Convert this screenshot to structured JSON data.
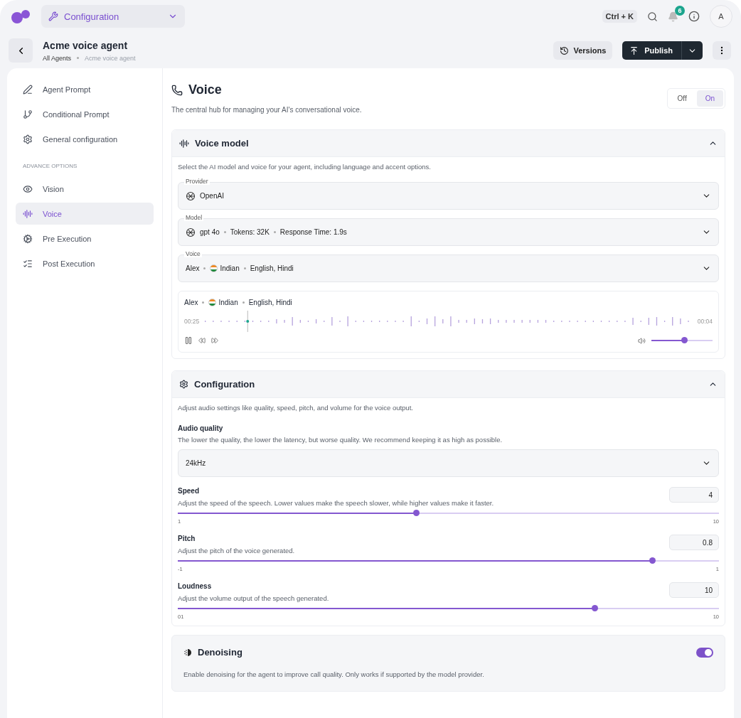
{
  "topbar": {
    "menu": "Configuration",
    "shortcut": "Ctrl + K",
    "notifications": "6",
    "avatar": "A"
  },
  "header": {
    "title": "Acme voice agent",
    "breadcrumbs": [
      {
        "label": "All Agents",
        "current": false
      },
      {
        "label": "Acme voice agent",
        "current": true
      }
    ],
    "versions": "Versions",
    "publish": "Publish"
  },
  "sidebar": {
    "items": [
      {
        "label": "Agent Prompt",
        "selected": false
      },
      {
        "label": "Conditional Prompt",
        "selected": false
      },
      {
        "label": "General configuration",
        "selected": false
      }
    ],
    "section": "ADVANCE OPTIONS",
    "advanced": [
      {
        "label": "Vision",
        "selected": false
      },
      {
        "label": "Voice",
        "selected": true
      },
      {
        "label": "Pre Execution",
        "selected": false
      },
      {
        "label": "Post Execution",
        "selected": false
      }
    ]
  },
  "page": {
    "title": "Voice",
    "description": "The central hub for managing your AI's conversational voice.",
    "toggle": [
      {
        "label": "Off",
        "selected": false
      },
      {
        "label": "On",
        "selected": true
      }
    ]
  },
  "voice_model": {
    "title": "Voice model",
    "expanded": true,
    "description": "Select the AI model and voice for your agent, including language and accent options.",
    "fields": [
      {
        "label": "Provider",
        "logo": true,
        "parts": [
          {
            "text": "OpenAI",
            "flag": false
          }
        ]
      },
      {
        "label": "Model",
        "logo": true,
        "parts": [
          {
            "text": "gpt 4o",
            "flag": false
          },
          {
            "text": "Tokens: 32K",
            "flag": false
          },
          {
            "text": "Response Time: 1.9s",
            "flag": false
          }
        ]
      },
      {
        "label": "Voice",
        "logo": false,
        "parts": [
          {
            "text": "Alex",
            "flag": false
          },
          {
            "text": "Indian",
            "flag": true
          },
          {
            "text": "English, Hindi",
            "flag": false
          }
        ]
      }
    ],
    "player": {
      "parts": [
        {
          "text": "Alex",
          "flag": false
        },
        {
          "text": "Indian",
          "flag": true
        },
        {
          "text": "English, Hindi",
          "flag": false
        }
      ],
      "elapsed": "00:25",
      "remaining": "00:04",
      "volume": {
        "level": 0.53
      }
    }
  },
  "configuration": {
    "title": "Configuration",
    "expanded": true,
    "description": "Adjust audio settings like quality, speed, pitch, and volume for the voice output.",
    "audio_quality": {
      "label": "Audio quality",
      "description": "The lower the quality, the lower the latency, but worse quality. We recommend keeping it as high as possible.",
      "value": "24kHz"
    },
    "sliders": [
      {
        "label": "Speed",
        "description": "Adjust the speed of the speech. Lower values make the speech slower, while higher values make it faster.",
        "value": "4",
        "min": "1",
        "max": "10",
        "level": 0.44
      },
      {
        "label": "Pitch",
        "description": "Adjust the pitch of the voice generated.",
        "value": "0.8",
        "min": "-1",
        "max": "1",
        "level": 0.877
      },
      {
        "label": "Loudness",
        "description": "Adjust the volume output of the speech generated.",
        "value": "10",
        "min": "01",
        "max": "10",
        "level": 0.77
      }
    ]
  },
  "denoising": {
    "title": "Denoising",
    "description": "Enable denoising for the agent to improve call quality. Only works if supported by the model provider.",
    "on": true
  }
}
